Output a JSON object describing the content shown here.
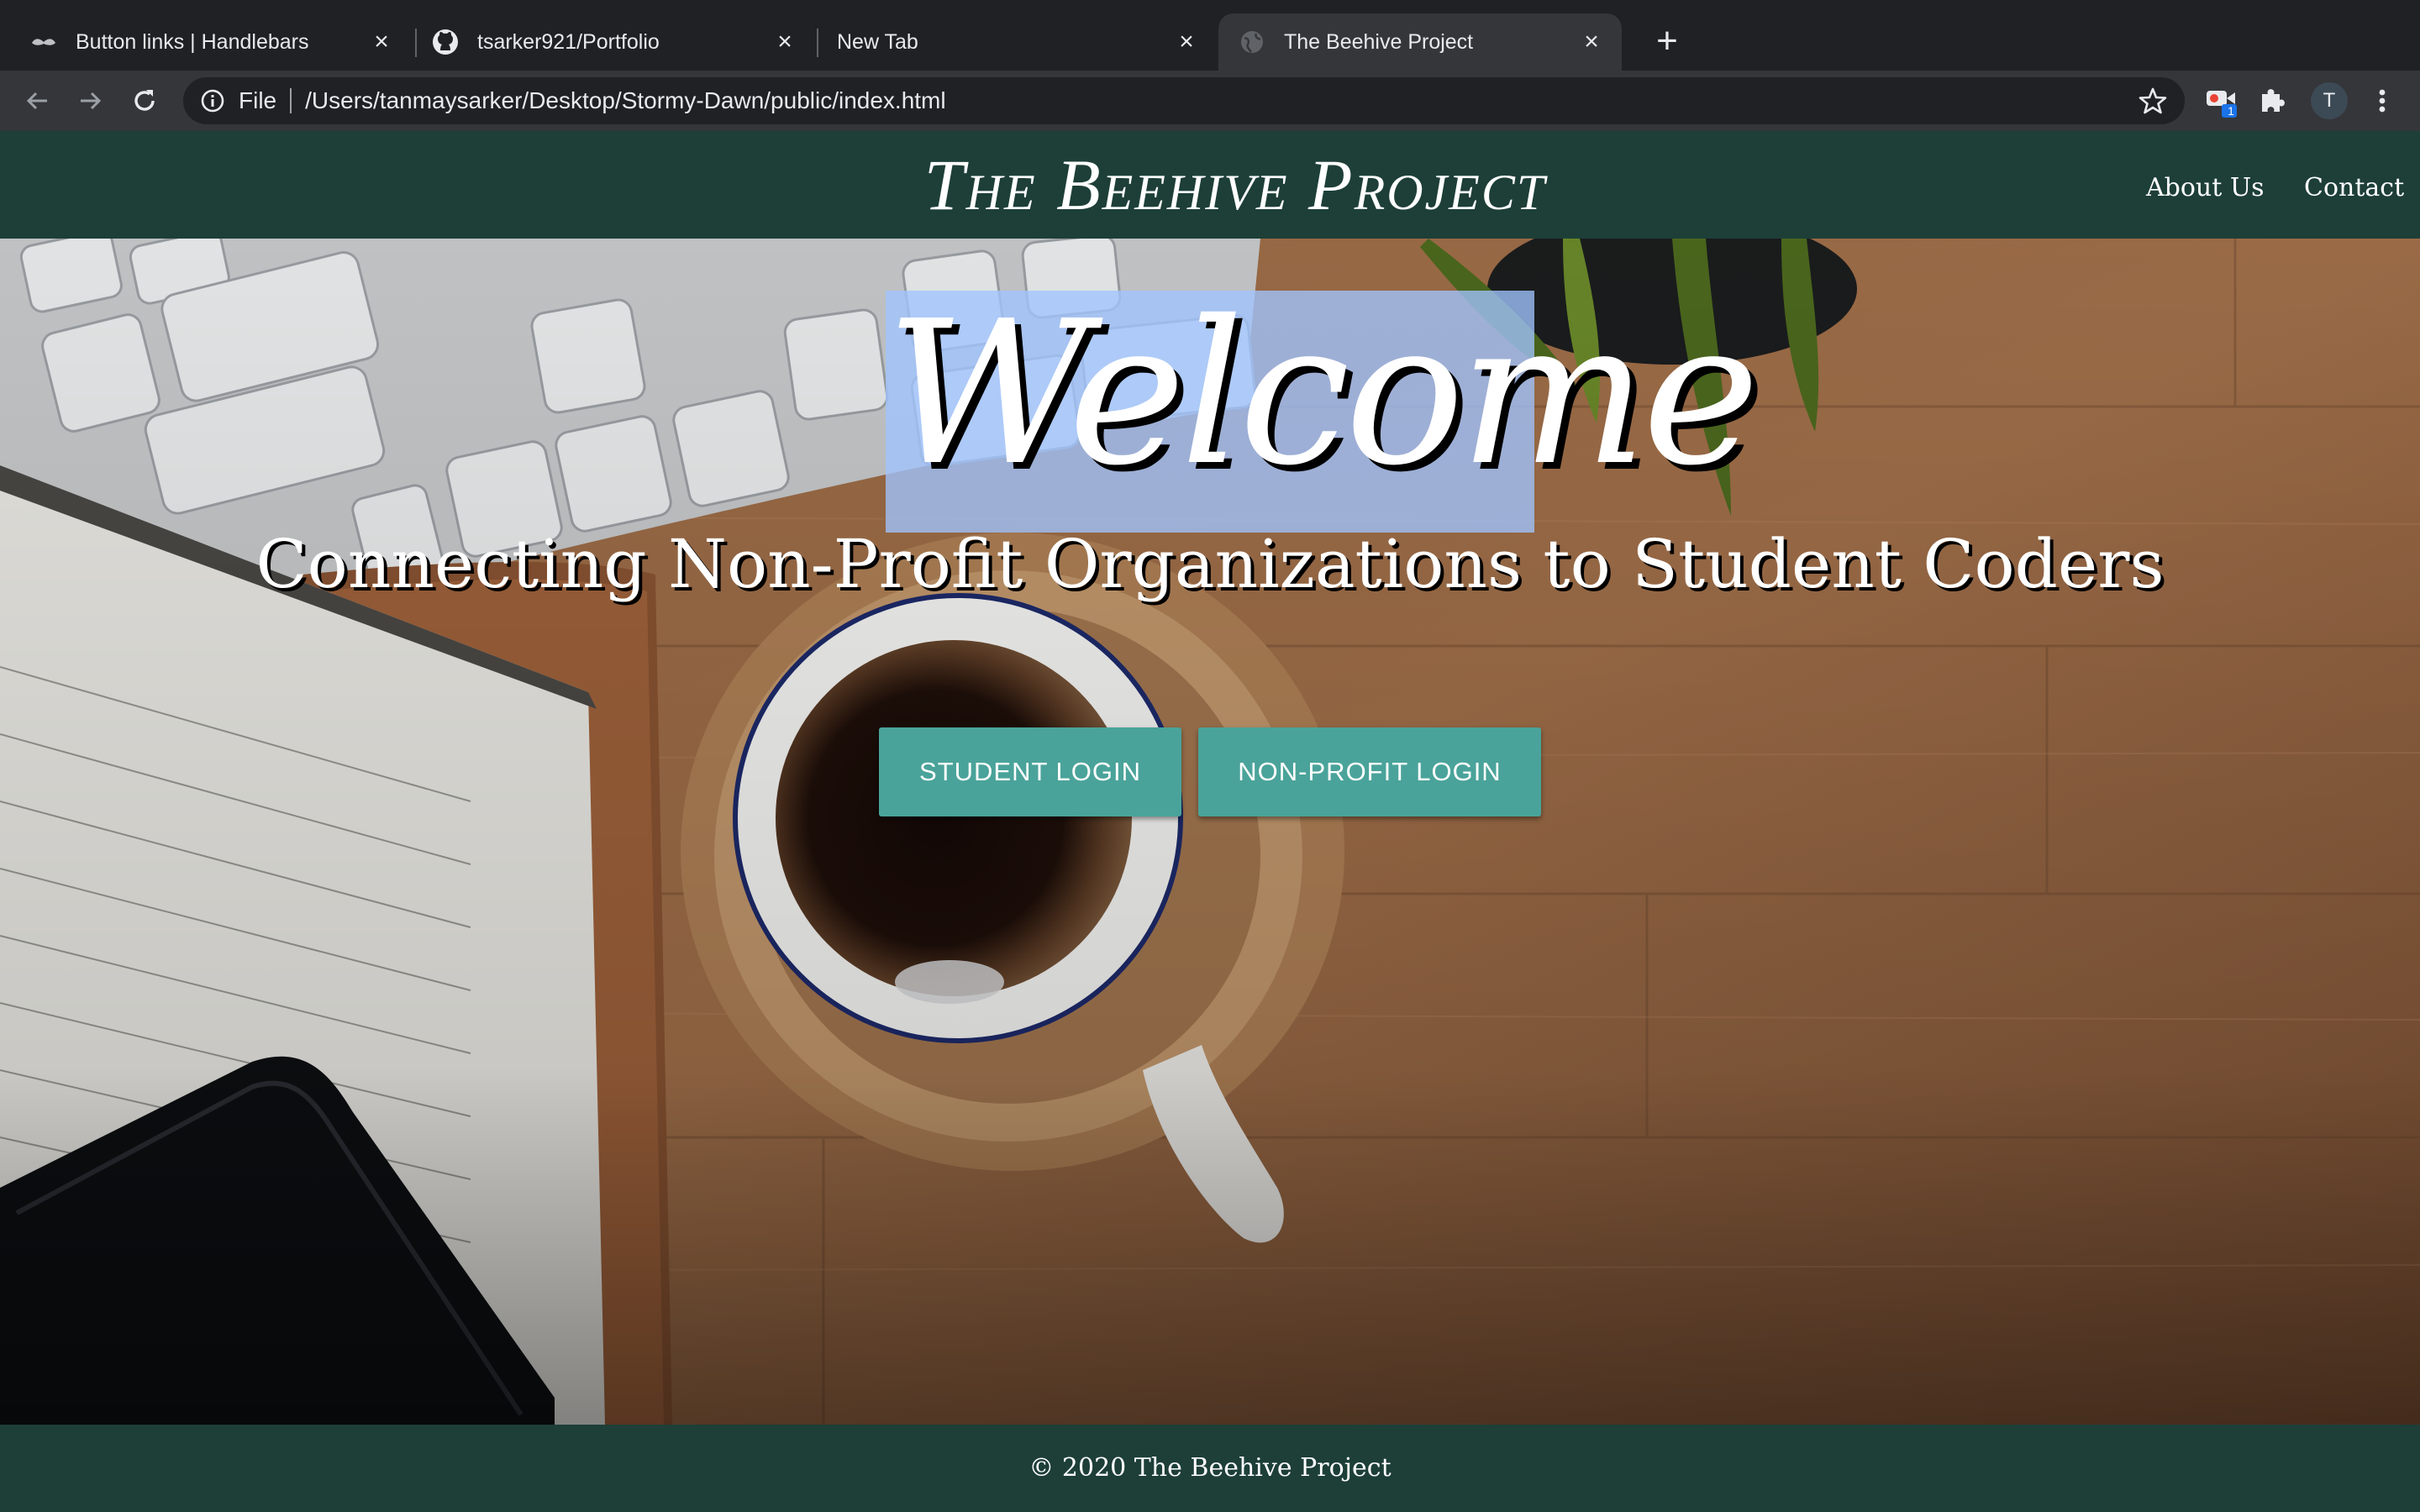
{
  "browser": {
    "tabs": [
      {
        "title": "Button links | Handlebars",
        "icon": "handlebars-mustache-icon",
        "active": false
      },
      {
        "title": "tsarker921/Portfolio",
        "icon": "github-icon",
        "active": false
      },
      {
        "title": "New Tab",
        "icon": "",
        "active": false
      },
      {
        "title": "The Beehive Project",
        "icon": "globe-icon",
        "active": true
      }
    ],
    "close_glyph": "×",
    "new_tab_glyph": "+",
    "address": {
      "scheme": "File",
      "url": "/Users/tanmaysarker/Desktop/Stormy-Dawn/public/index.html"
    },
    "extension_badge": "1",
    "profile_initial": "T"
  },
  "page": {
    "brand": "The Beehive Project",
    "nav": {
      "about": "About Us",
      "contact": "Contact"
    },
    "hero": {
      "welcome": "Welcome",
      "tagline": "Connecting Non-Profit Organizations to Student Coders",
      "student_login": "STUDENT LOGIN",
      "nonprofit_login": "NON-PROFIT LOGIN"
    },
    "footer": "© 2020 The Beehive Project"
  },
  "colors": {
    "navbar": "#1d3f38",
    "button": "#4aa39a",
    "selection": "#a0c4ff",
    "tabstrip": "#202124",
    "toolbar": "#35363a"
  }
}
